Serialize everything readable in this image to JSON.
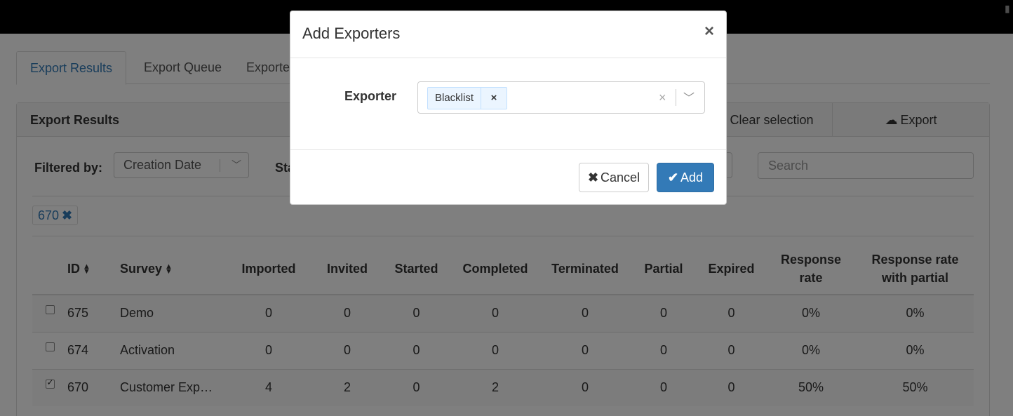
{
  "tabs": [
    {
      "label": "Export Results",
      "active": true
    },
    {
      "label": "Export Queue",
      "active": false
    },
    {
      "label": "Exporters",
      "active": false
    }
  ],
  "panel": {
    "title": "Export Results",
    "clear_selection": "Clear selection",
    "export_label": "Export",
    "export_icon": "cloud-download-icon"
  },
  "filters": {
    "filtered_by_label": "Filtered by:",
    "filter_select_value": "Creation Date",
    "status_label": "Status",
    "search_placeholder": "Search"
  },
  "active_chip": {
    "label": "670",
    "remove_icon": "close-icon"
  },
  "table": {
    "columns": [
      "",
      "ID",
      "Survey",
      "Imported",
      "Invited",
      "Started",
      "Completed",
      "Terminated",
      "Partial",
      "Expired",
      "Response rate",
      "Response rate with partial"
    ],
    "rows": [
      {
        "checked": false,
        "id": "675",
        "survey": "Demo",
        "imported": "0",
        "invited": "0",
        "started": "0",
        "completed": "0",
        "terminated": "0",
        "partial": "0",
        "expired": "0",
        "response_rate": "0%",
        "response_rate_partial": "0%"
      },
      {
        "checked": false,
        "id": "674",
        "survey": "Activation",
        "imported": "0",
        "invited": "0",
        "started": "0",
        "completed": "0",
        "terminated": "0",
        "partial": "0",
        "expired": "0",
        "response_rate": "0%",
        "response_rate_partial": "0%"
      },
      {
        "checked": true,
        "id": "670",
        "survey": "Customer Exp…",
        "imported": "4",
        "invited": "2",
        "started": "0",
        "completed": "2",
        "terminated": "0",
        "partial": "0",
        "expired": "0",
        "response_rate": "50%",
        "response_rate_partial": "50%"
      }
    ]
  },
  "modal": {
    "title": "Add Exporters",
    "close_symbol": "×",
    "exporter_label": "Exporter",
    "selected_tags": [
      "Blacklist"
    ],
    "tag_remove_symbol": "×",
    "clear_symbol": "×",
    "cancel_label": "Cancel",
    "add_label": "Add"
  },
  "colors": {
    "primary": "#337ab7",
    "tag_bg": "#ebf5ff",
    "overlay": "rgba(0,0,0,0.5)"
  }
}
